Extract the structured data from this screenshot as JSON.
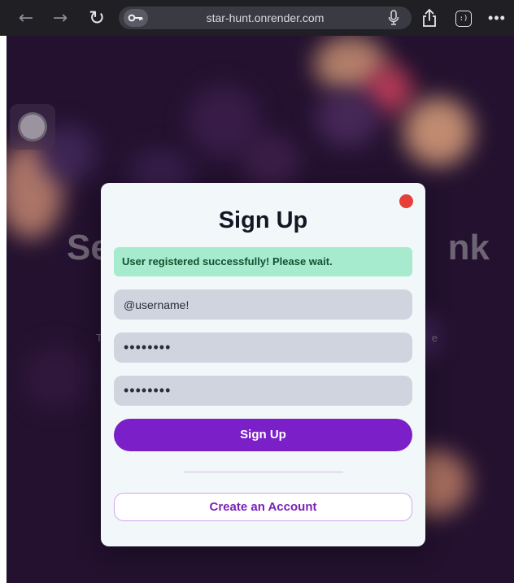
{
  "browser": {
    "url": "star-hunt.onrender.com",
    "back_glyph": "←",
    "forward_glyph": "→",
    "reload_glyph": "↻",
    "more_glyph": "•••",
    "extension_glyph": ":)",
    "icons": {
      "key": "key-icon",
      "mic": "microphone-icon",
      "share": "share-icon",
      "extension": "extension-icon",
      "more": "more-icon"
    }
  },
  "background": {
    "heading_left": "Se",
    "heading_right": "nk",
    "subtext_left": "T",
    "subtext_right": "e"
  },
  "modal": {
    "title": "Sign Up",
    "success_message": "User registered successfully! Please wait.",
    "username_value": "@username!",
    "password_value": "••••••••",
    "confirm_password_value": "••••••••",
    "signup_label": "Sign Up",
    "create_account_label": "Create an Account",
    "colors": {
      "primary": "#7b1fc8",
      "success_bg": "#a6ebcd",
      "close": "#e5403a"
    }
  }
}
